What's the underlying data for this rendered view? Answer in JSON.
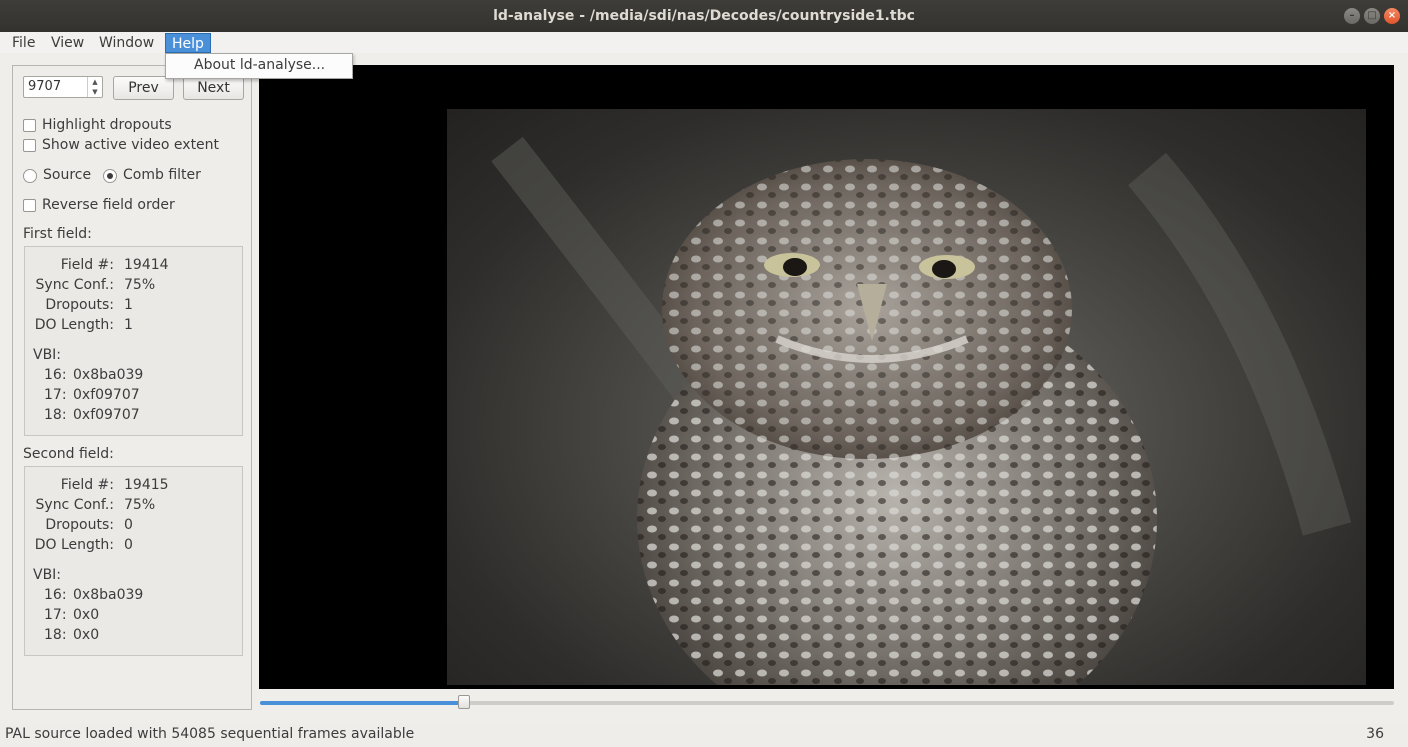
{
  "window": {
    "title": "ld-analyse - /media/sdi/nas/Decodes/countryside1.tbc"
  },
  "menu": {
    "file": "File",
    "view": "View",
    "window": "Window",
    "help": "Help",
    "about": "About ld-analyse..."
  },
  "controls": {
    "frame_number": "9707",
    "prev": "Prev",
    "next": "Next",
    "highlight_dropouts": "Highlight dropouts",
    "show_active_video": "Show active video extent",
    "source": "Source",
    "comb_filter": "Comb filter",
    "reverse_field_order": "Reverse field order"
  },
  "first_field": {
    "heading": "First field:",
    "field_label": "Field #:",
    "field_value": "19414",
    "sync_label": "Sync Conf.:",
    "sync_value": "75%",
    "dropouts_label": "Dropouts:",
    "dropouts_value": "1",
    "dolength_label": "DO Length:",
    "dolength_value": "1",
    "vbi_label": "VBI:",
    "vbi": [
      {
        "line": "16:",
        "value": "0x8ba039"
      },
      {
        "line": "17:",
        "value": "0xf09707"
      },
      {
        "line": "18:",
        "value": "0xf09707"
      }
    ]
  },
  "second_field": {
    "heading": "Second field:",
    "field_label": "Field #:",
    "field_value": "19415",
    "sync_label": "Sync Conf.:",
    "sync_value": "75%",
    "dropouts_label": "Dropouts:",
    "dropouts_value": "0",
    "dolength_label": "DO Length:",
    "dolength_value": "0",
    "vbi_label": "VBI:",
    "vbi": [
      {
        "line": "16:",
        "value": "0x8ba039"
      },
      {
        "line": "17:",
        "value": "0x0"
      },
      {
        "line": "18:",
        "value": "0x0"
      }
    ]
  },
  "slider": {
    "position_fraction": 0.18
  },
  "status": {
    "message": "PAL source loaded with 54085 sequential frames available",
    "counter": "36"
  },
  "colors": {
    "accent": "#4a90d9",
    "close_button": "#e95420"
  }
}
